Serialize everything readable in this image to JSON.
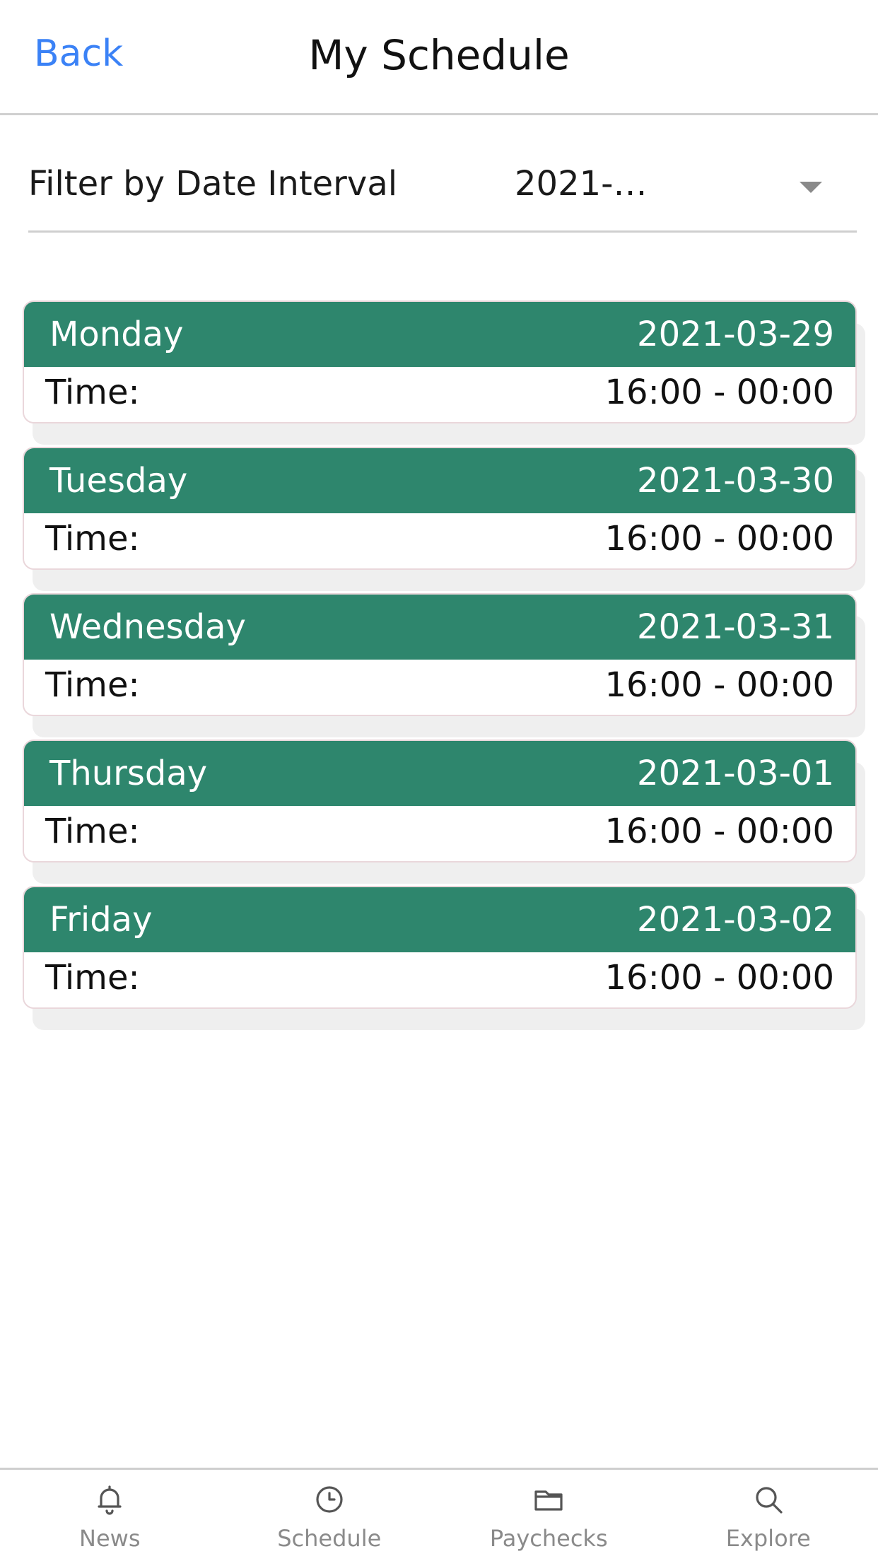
{
  "header": {
    "back_label": "Back",
    "title": "My Schedule"
  },
  "filter": {
    "label": "Filter by Date Interval",
    "value": "2021-03-29 - 2..."
  },
  "days": [
    {
      "day": "Monday",
      "date": "2021-03-29",
      "time_label": "Time:",
      "time": "16:00 - 00:00"
    },
    {
      "day": "Tuesday",
      "date": "2021-03-30",
      "time_label": "Time:",
      "time": "16:00 - 00:00"
    },
    {
      "day": "Wednesday",
      "date": "2021-03-31",
      "time_label": "Time:",
      "time": "16:00 - 00:00"
    },
    {
      "day": "Thursday",
      "date": "2021-03-01",
      "time_label": "Time:",
      "time": "16:00 - 00:00"
    },
    {
      "day": "Friday",
      "date": "2021-03-02",
      "time_label": "Time:",
      "time": "16:00 - 00:00"
    }
  ],
  "nav": {
    "items": [
      {
        "label": "News",
        "icon": "bell-icon"
      },
      {
        "label": "Schedule",
        "icon": "clock-icon"
      },
      {
        "label": "Paychecks",
        "icon": "folder-icon"
      },
      {
        "label": "Explore",
        "icon": "search-icon"
      }
    ]
  },
  "colors": {
    "accent": "#3b82f6",
    "card_header": "#2e866d",
    "nav_icon": "#555555"
  }
}
